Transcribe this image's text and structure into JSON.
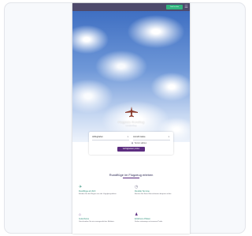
{
  "header": {
    "cta_label": "Jetzt buchen",
    "menu_icon": "menu-icon"
  },
  "hero": {
    "logo_icon": "airplane-icon",
    "title": "Flugplatz Rundflug",
    "subtitle": "Lindenflug"
  },
  "booking": {
    "from_value": "Abflughafen",
    "to_value": "Anzahl Gäste",
    "date_value": "Termin wählen",
    "search_label": "Verfügbarkeit prüfen"
  },
  "features_section": {
    "title": "Rundflüge im Flugzeug erleben"
  },
  "features": [
    {
      "icon": "plane-icon",
      "title": "Rundflüge ab 49 €",
      "text": "Erleben Sie die Region aus der Vogelperspektive."
    },
    {
      "icon": "clock-icon",
      "title": "Flexible Termine",
      "text": "Buchen Sie Ihren Wunschtermin bequem online."
    },
    {
      "icon": "gift-icon",
      "title": "Gutscheine",
      "text": "Verschenken Sie ein unvergessliches Erlebnis."
    },
    {
      "icon": "pilot-icon",
      "title": "Erfahrene Piloten",
      "text": "Sicher unterwegs mit unseren Profis."
    }
  ],
  "colors": {
    "topbar": "#4e4a6b",
    "cta": "#34b47f",
    "accent": "#5c2d80",
    "feature_title": "#2f8f7a",
    "heading": "#2d2a55"
  }
}
